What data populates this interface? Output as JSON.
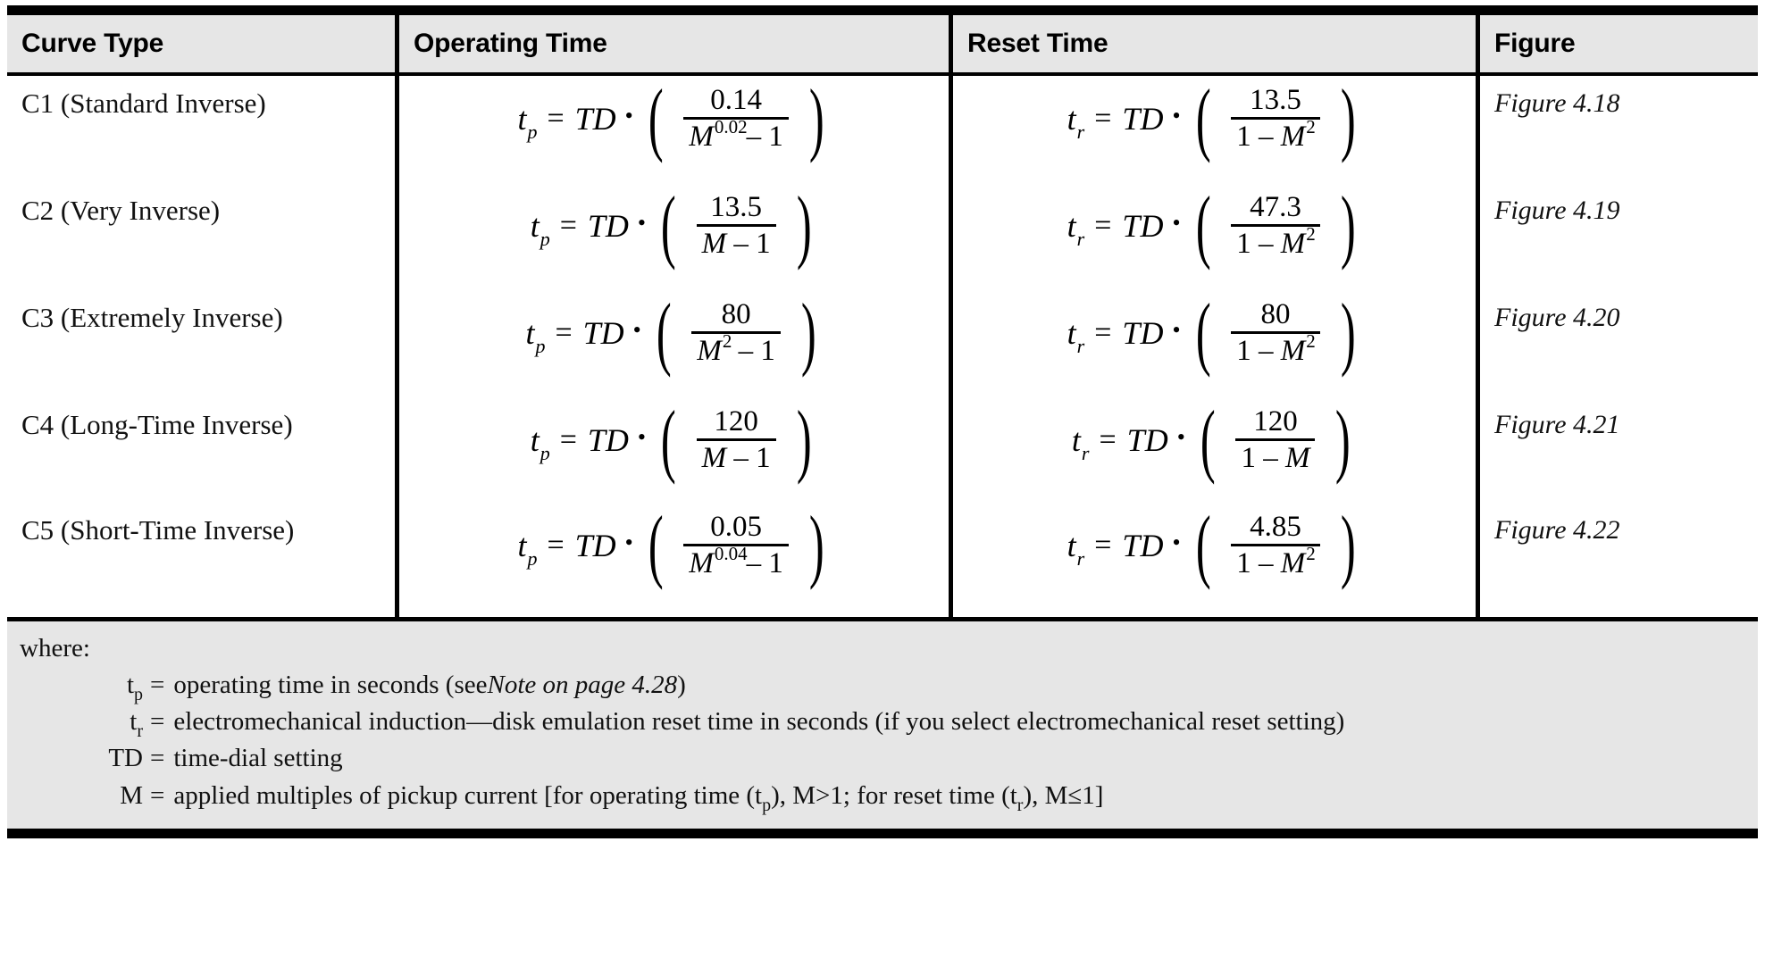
{
  "table": {
    "headers": [
      {
        "id": "curve-type",
        "label": "Curve Type"
      },
      {
        "id": "operating-time",
        "label": "Operating Time"
      },
      {
        "id": "reset-time",
        "label": "Reset Time"
      },
      {
        "id": "figure",
        "label": "Figure"
      }
    ],
    "rows": [
      {
        "curve_type": "C1 (Standard Inverse)",
        "operating": {
          "lhs_var": "t",
          "lhs_sub": "p",
          "eq": "=",
          "td": "TD",
          "dot": "•",
          "numerator": "0.14",
          "den_base": "M",
          "den_exp": "0.02",
          "den_tail": "– 1",
          "text": "tp = TD • (0.14 / (M^0.02 – 1))"
        },
        "reset": {
          "lhs_var": "t",
          "lhs_sub": "r",
          "eq": "=",
          "td": "TD",
          "dot": "•",
          "numerator": "13.5",
          "den_lead": "1 – ",
          "den_base": "M",
          "den_exp": "2",
          "den_tail": "",
          "text": "tr = TD • (13.5 / (1 – M^2))"
        },
        "figure": "Figure 4.18"
      },
      {
        "curve_type": "C2 (Very Inverse)",
        "operating": {
          "lhs_var": "t",
          "lhs_sub": "p",
          "eq": "=",
          "td": "TD",
          "dot": "•",
          "numerator": "13.5",
          "den_base": "M",
          "den_exp": "",
          "den_tail": " – 1",
          "text": "tp = TD • (13.5 / (M – 1))"
        },
        "reset": {
          "lhs_var": "t",
          "lhs_sub": "r",
          "eq": "=",
          "td": "TD",
          "dot": "•",
          "numerator": "47.3",
          "den_lead": "1 – ",
          "den_base": "M",
          "den_exp": "2",
          "den_tail": "",
          "text": "tr = TD • (47.3 / (1 – M^2))"
        },
        "figure": "Figure 4.19"
      },
      {
        "curve_type": "C3 (Extremely Inverse)",
        "operating": {
          "lhs_var": "t",
          "lhs_sub": "p",
          "eq": "=",
          "td": "TD",
          "dot": "•",
          "numerator": "80",
          "den_base": "M",
          "den_exp": "2",
          "den_tail": " – 1",
          "text": "tp = TD • (80 / (M^2 – 1))"
        },
        "reset": {
          "lhs_var": "t",
          "lhs_sub": "r",
          "eq": "=",
          "td": "TD",
          "dot": "•",
          "numerator": "80",
          "den_lead": "1 – ",
          "den_base": "M",
          "den_exp": "2",
          "den_tail": "",
          "text": "tr = TD • (80 / (1 – M^2))"
        },
        "figure": "Figure 4.20"
      },
      {
        "curve_type": "C4 (Long-Time Inverse)",
        "operating": {
          "lhs_var": "t",
          "lhs_sub": "p",
          "eq": "=",
          "td": "TD",
          "dot": "•",
          "numerator": "120",
          "den_base": "M",
          "den_exp": "",
          "den_tail": " – 1",
          "text": "tp = TD • (120 / (M – 1))"
        },
        "reset": {
          "lhs_var": "t",
          "lhs_sub": "r",
          "eq": "=",
          "td": "TD",
          "dot": "•",
          "numerator": "120",
          "den_lead": "1 – ",
          "den_base": "M",
          "den_exp": "",
          "den_tail": "",
          "text": "tr = TD • (120 / (1 – M))"
        },
        "figure": "Figure 4.21"
      },
      {
        "curve_type": "C5 (Short-Time Inverse)",
        "operating": {
          "lhs_var": "t",
          "lhs_sub": "p",
          "eq": "=",
          "td": "TD",
          "dot": "•",
          "numerator": "0.05",
          "den_base": "M",
          "den_exp": "0.04",
          "den_tail": "– 1",
          "text": "tp = TD • (0.05 / (M^0.04 – 1))"
        },
        "reset": {
          "lhs_var": "t",
          "lhs_sub": "r",
          "eq": "=",
          "td": "TD",
          "dot": "•",
          "numerator": "4.85",
          "den_lead": "1 – ",
          "den_base": "M",
          "den_exp": "2",
          "den_tail": "",
          "text": "tr = TD • (4.85 / (1 – M^2))"
        },
        "figure": "Figure 4.22"
      }
    ]
  },
  "footnote": {
    "where_label": "where:",
    "definitions": [
      {
        "symbol": "t",
        "symbol_sub": "p",
        "eq": "=",
        "text_before": "operating time in seconds (see ",
        "italic": "Note on page 4.28",
        "text_after": ")"
      },
      {
        "symbol": "t",
        "symbol_sub": "r",
        "eq": "=",
        "text_before": "electromechanical induction—disk emulation reset time in seconds (if you select electromechanical reset setting)",
        "italic": "",
        "text_after": ""
      },
      {
        "symbol": "TD",
        "symbol_sub": "",
        "eq": "=",
        "text_before": "time-dial setting",
        "italic": "",
        "text_after": ""
      },
      {
        "symbol": "M",
        "symbol_sub": "",
        "eq": "=",
        "text_before": "applied multiples of pickup current [for operating time (t",
        "italic": "",
        "text_after": "), M>1; for reset time (t",
        "sub_a": "p",
        "sub_b": "r",
        "text_end": "), M≤1]"
      }
    ]
  },
  "colors": {
    "header_bg": "#e6e6e6",
    "footnote_bg": "#e6e6e6",
    "rule": "#000000",
    "text": "#111111",
    "page_bg": "#ffffff"
  }
}
